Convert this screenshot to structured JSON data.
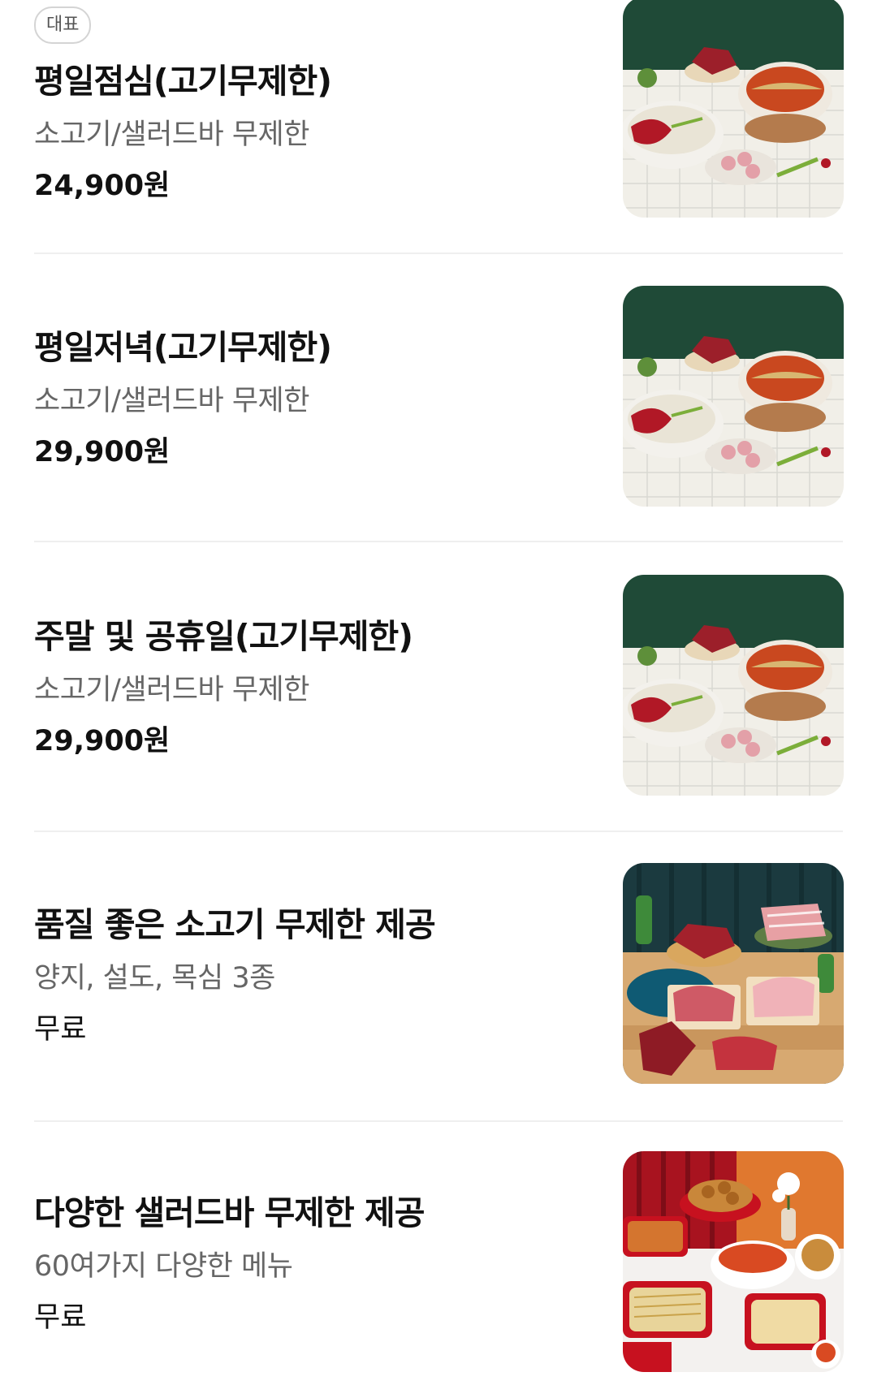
{
  "menu": {
    "items": [
      {
        "badge": "대표",
        "name": "평일점심(고기무제한)",
        "desc": "소고기/샐러드바 무제한",
        "price": "24,900원",
        "photo": "hotpot-meat-photo"
      },
      {
        "name": "평일저녁(고기무제한)",
        "desc": "소고기/샐러드바 무제한",
        "price": "29,900원",
        "photo": "hotpot-meat-photo"
      },
      {
        "name": "주말 및 공휴일(고기무제한)",
        "desc": "소고기/샐러드바 무제한",
        "price": "29,900원",
        "photo": "hotpot-meat-photo"
      },
      {
        "name": "품질 좋은 소고기 무제한 제공",
        "desc": "양지, 설도, 목심 3종",
        "price": "무료",
        "photo": "raw-beef-platter-photo"
      },
      {
        "name": "다양한 샐러드바 무제한 제공",
        "desc": "60여가지 다양한 메뉴",
        "price": "무료",
        "photo": "salad-bar-dishes-photo"
      }
    ]
  },
  "colors": {
    "text_primary": "#111111",
    "text_secondary": "#666666",
    "divider": "#efefef",
    "badge_border": "#d4d4d4"
  }
}
